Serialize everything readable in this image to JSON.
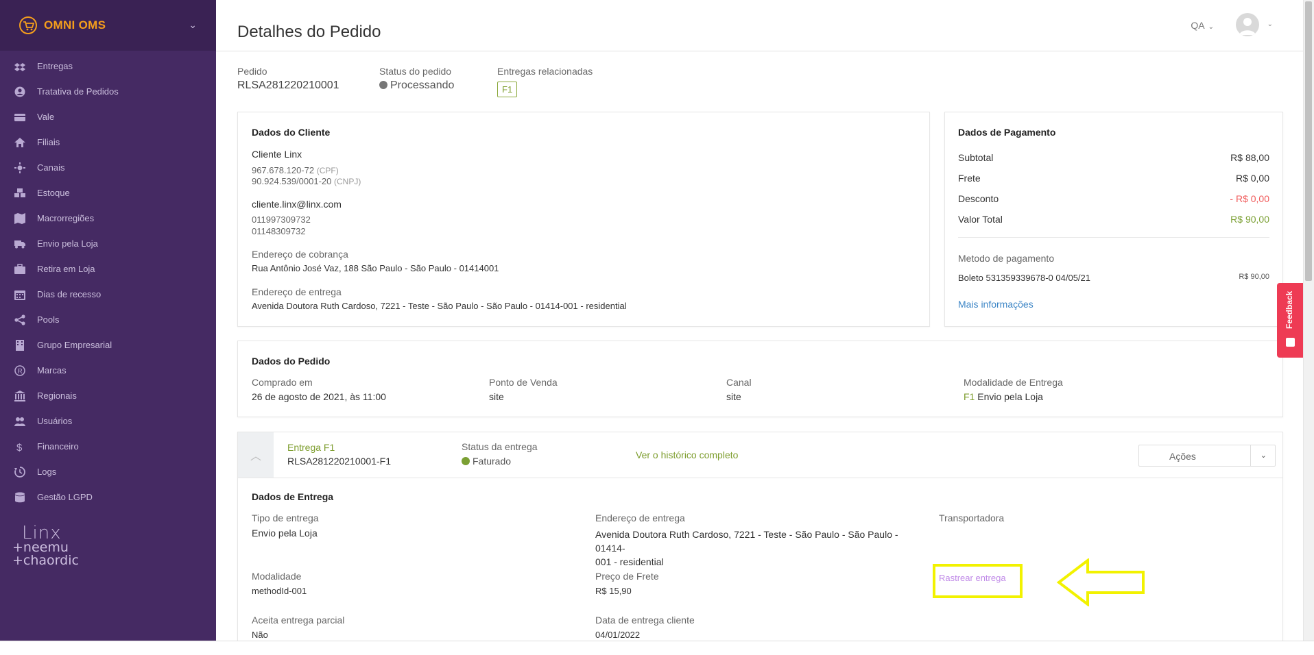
{
  "app": {
    "name": "OMNI OMS",
    "title": "Detalhes do Pedido",
    "environment": "QA"
  },
  "sidebar": {
    "items": [
      {
        "label": "Entregas",
        "icon": "dropbox-icon"
      },
      {
        "label": "Tratativa de Pedidos",
        "icon": "user-circle-icon"
      },
      {
        "label": "Vale",
        "icon": "credit-card-icon"
      },
      {
        "label": "Filiais",
        "icon": "home-icon"
      },
      {
        "label": "Canais",
        "icon": "sun-icon"
      },
      {
        "label": "Estoque",
        "icon": "cubes-icon"
      },
      {
        "label": "Macrorregiões",
        "icon": "map-icon"
      },
      {
        "label": "Envio pela Loja",
        "icon": "truck-icon"
      },
      {
        "label": "Retira em Loja",
        "icon": "briefcase-icon"
      },
      {
        "label": "Dias de recesso",
        "icon": "calendar-icon"
      },
      {
        "label": "Pools",
        "icon": "share-icon"
      },
      {
        "label": "Grupo Empresarial",
        "icon": "building-icon"
      },
      {
        "label": "Marcas",
        "icon": "registered-icon"
      },
      {
        "label": "Regionais",
        "icon": "bank-icon"
      },
      {
        "label": "Usuários",
        "icon": "users-icon"
      },
      {
        "label": "Financeiro",
        "icon": "dollar-icon"
      },
      {
        "label": "Logs",
        "icon": "history-icon"
      },
      {
        "label": "Gestão LGPD",
        "icon": "database-icon"
      }
    ],
    "footer_logo_line1": "Linx",
    "footer_logo_line2": "+neemu",
    "footer_logo_line3": "+chaordic"
  },
  "order": {
    "pedido_label": "Pedido",
    "pedido_value": "RLSA281220210001",
    "status_label": "Status do pedido",
    "status_value": "Processando",
    "related_label": "Entregas relacionadas",
    "related_badge": "F1"
  },
  "customer": {
    "title": "Dados do Cliente",
    "name": "Cliente Linx",
    "cpf": "967.678.120-72",
    "cpf_suffix": "(CPF)",
    "cnpj": "90.924.539/0001-20",
    "cnpj_suffix": "(CNPJ)",
    "email": "cliente.linx@linx.com",
    "phone1": "011997309732",
    "phone2": "01148309732",
    "billing_label": "Endereço de cobrança",
    "billing_address": "Rua Antônio José Vaz, 188 São Paulo - São Paulo - 01414001",
    "delivery_label": "Endereço de entrega",
    "delivery_address": "Avenida Doutora Ruth Cardoso, 7221 - Teste - São Paulo - São Paulo - 01414-001 - residential"
  },
  "payment": {
    "title": "Dados de Pagamento",
    "subtotal_label": "Subtotal",
    "subtotal_value": "R$ 88,00",
    "frete_label": "Frete",
    "frete_value": "R$ 0,00",
    "desconto_label": "Desconto",
    "desconto_value": "- R$ 0,00",
    "total_label": "Valor Total",
    "total_value": "R$ 90,00",
    "method_label": "Metodo de pagamento",
    "method_value": "Boleto 531359339678-0 04/05/21",
    "method_amount": "R$ 90,00",
    "more_link": "Mais informações"
  },
  "order_data": {
    "title": "Dados do Pedido",
    "comprado_label": "Comprado em",
    "comprado_value": "26 de agosto de 2021, às 11:00",
    "pdv_label": "Ponto de Venda",
    "pdv_value": "site",
    "canal_label": "Canal",
    "canal_value": "site",
    "modalidade_label": "Modalidade de Entrega",
    "modalidade_code": "F1",
    "modalidade_value": "Envio pela Loja"
  },
  "delivery": {
    "entrega_label": "Entrega F1",
    "entrega_id": "RLSA281220210001-F1",
    "status_label": "Status da entrega",
    "status_value": "Faturado",
    "history_link": "Ver o histórico completo",
    "actions_label": "Ações",
    "section_title": "Dados de Entrega",
    "tipo_label": "Tipo de entrega",
    "tipo_value": "Envio pela Loja",
    "endereco_label": "Endereço de entrega",
    "endereco_line1": "Avenida Doutora Ruth Cardoso, 7221 - Teste - São Paulo - São Paulo - 01414-",
    "endereco_line2": "001 - residential",
    "transportadora_label": "Transportadora",
    "rastrear_link": "Rastrear entrega",
    "modalidade_label": "Modalidade",
    "modalidade_value": "methodId-001",
    "preco_label": "Preço de Frete",
    "preco_value": "R$ 15,90",
    "parcial_label": "Aceita entrega parcial",
    "parcial_value": "Não",
    "data_label": "Data de entrega cliente",
    "data_value": "04/01/2022"
  },
  "feedback_label": "Feedback",
  "colors": {
    "sidebar": "#452a63",
    "brand": "#f59e1c",
    "accent_green": "#7ba034",
    "danger": "#f05a5a",
    "link_blue": "#3d86c6",
    "feedback": "#ee3b54",
    "highlight": "#f2f200"
  }
}
